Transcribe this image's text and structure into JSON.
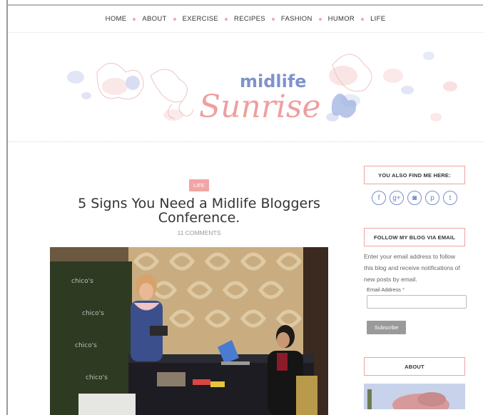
{
  "nav": {
    "items": [
      {
        "label": "HOME"
      },
      {
        "label": "ABOUT"
      },
      {
        "label": "EXERCISE"
      },
      {
        "label": "RECIPES"
      },
      {
        "label": "FASHION"
      },
      {
        "label": "HUMOR"
      },
      {
        "label": "LIFE"
      }
    ]
  },
  "header": {
    "logo_line1": "midlife",
    "logo_line2": "Sunrise"
  },
  "post": {
    "category": "LIFE",
    "title": "5 Signs You Need a Midlife Bloggers Conference.",
    "comments": "11 COMMENTS",
    "banner_text": "chico's"
  },
  "sidebar": {
    "social_title": "YOU ALSO FIND ME HERE:",
    "social_icons": [
      {
        "name": "facebook-icon",
        "glyph": "f"
      },
      {
        "name": "google-plus-icon",
        "glyph": "g+"
      },
      {
        "name": "instagram-icon",
        "glyph": "◙"
      },
      {
        "name": "pinterest-icon",
        "glyph": "p"
      },
      {
        "name": "twitter-icon",
        "glyph": "t"
      }
    ],
    "follow_title": "FOLLOW MY BLOG VIA EMAIL",
    "follow_desc": "Enter your email address to follow this blog and receive notifications of new posts by email.",
    "email_label": "Email Address",
    "email_required": "*",
    "email_value": "",
    "subscribe_label": "Subscribe",
    "about_title": "ABOUT"
  },
  "colors": {
    "accent_pink": "#f2a5a5",
    "social_blue": "#7b8ec9"
  }
}
